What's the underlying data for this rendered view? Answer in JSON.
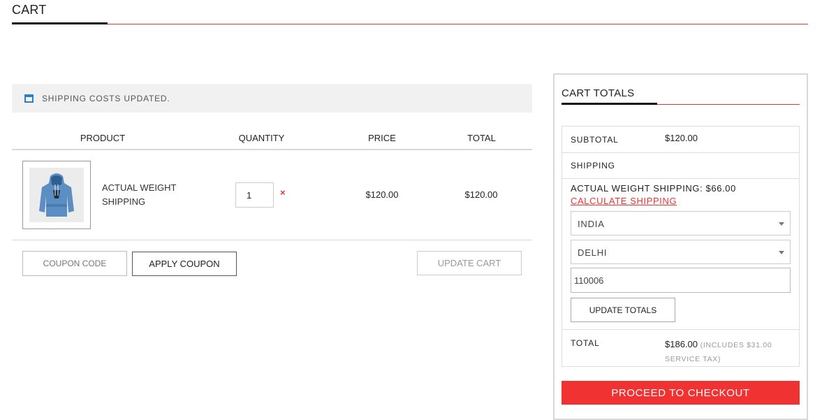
{
  "page": {
    "title": "CART"
  },
  "notice": {
    "text": "SHIPPING COSTS UPDATED.",
    "icon": "calendar-icon"
  },
  "cart": {
    "headers": {
      "product": "PRODUCT",
      "quantity": "QUANTITY",
      "price": "PRICE",
      "total": "TOTAL"
    },
    "items": [
      {
        "name": "ACTUAL WEIGHT SHIPPING",
        "quantity": "1",
        "remove": "×",
        "price": "$120.00",
        "total": "$120.00",
        "image": "blue-hoodie"
      }
    ],
    "coupon_placeholder": "COUPON CODE",
    "apply_coupon_label": "APPLY COUPON",
    "update_cart_label": "UPDATE CART"
  },
  "totals": {
    "title": "CART TOTALS",
    "subtotal_label": "SUBTOTAL",
    "subtotal_value": "$120.00",
    "shipping_label": "SHIPPING",
    "shipping_method": "ACTUAL WEIGHT SHIPPING: $66.00",
    "calculate_shipping_label": "CALCULATE SHIPPING",
    "country": "INDIA",
    "state": "DELHI",
    "postcode": "110006",
    "update_totals_label": "UPDATE TOTALS",
    "total_label": "TOTAL",
    "total_value": "$186.00",
    "tax_note": "(INCLUDES $31.00 SERVICE TAX)",
    "checkout_label": "PROCEED TO CHECKOUT"
  },
  "colors": {
    "accent": "#f03232",
    "notice_icon": "#2f7ec4"
  }
}
